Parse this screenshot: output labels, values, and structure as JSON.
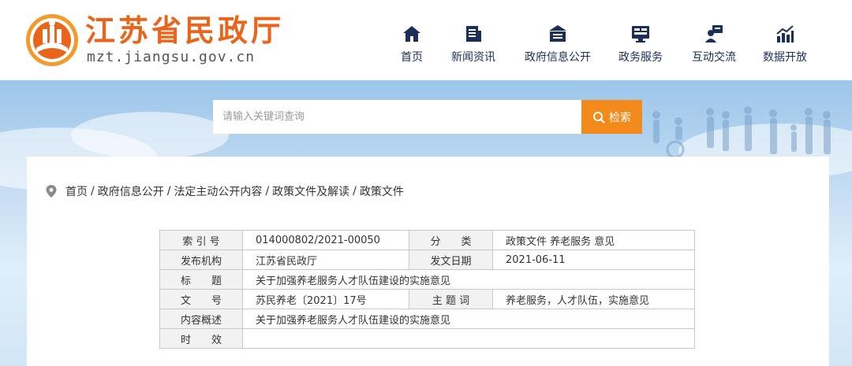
{
  "site": {
    "title": "江苏省民政厅",
    "url": "mzt.jiangsu.gov.cn"
  },
  "nav": [
    {
      "label": "首页",
      "icon": "home-icon"
    },
    {
      "label": "新闻资讯",
      "icon": "news-icon"
    },
    {
      "label": "政府信息公开",
      "icon": "government-building-icon"
    },
    {
      "label": "政务服务",
      "icon": "monitor-service-icon"
    },
    {
      "label": "互动交流",
      "icon": "user-chat-icon"
    },
    {
      "label": "数据开放",
      "icon": "bar-chart-icon"
    }
  ],
  "search": {
    "placeholder": "请输入关键词查询",
    "button_label": "检索",
    "button_icon": "search-icon"
  },
  "breadcrumb": {
    "icon": "location-pin-icon",
    "items": [
      "首页",
      "政府信息公开",
      "法定主动公开内容",
      "政策文件及解读",
      "政策文件"
    ]
  },
  "meta": {
    "index_label": "索 引 号",
    "index_value": "014000802/2021-00050",
    "category_label": "分　　类",
    "category_value": "政策文件 养老服务 意见",
    "issuer_label": "发布机构",
    "issuer_value": "江苏省民政厅",
    "date_label": "发文日期",
    "date_value": "2021-06-11",
    "title_label": "标　　题",
    "title_value": "关于加强养老服务人才队伍建设的实施意见",
    "docno_label": "文　　号",
    "docno_value": "苏民养老〔2021〕17号",
    "keywords_label": "主 题 词",
    "keywords_value": "养老服务，人才队伍，实施意见",
    "summary_label": "内容概述",
    "summary_value": "关于加强养老服务人才队伍建设的实施意见",
    "validity_label": "时　　效",
    "validity_value": ""
  },
  "colors": {
    "brand_orange": "#e8651b",
    "nav_text": "#1c2f5a",
    "search_button": "#f28a1c",
    "banner_sky": "#9cc6ea"
  }
}
